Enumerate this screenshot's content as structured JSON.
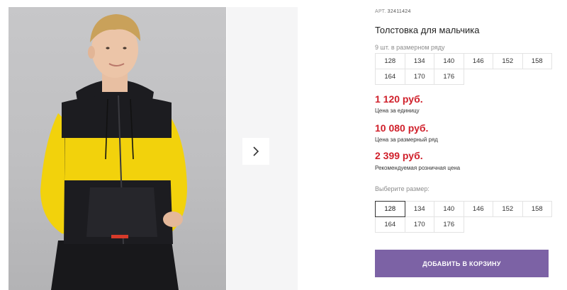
{
  "product": {
    "sku_label": "АРТ.",
    "sku_value": "32411424",
    "title": "Толстовка для мальчика"
  },
  "size_range": {
    "caption": "9 шт. в размерном ряду",
    "sizes": [
      "128",
      "134",
      "140",
      "146",
      "152",
      "158",
      "164",
      "170",
      "176"
    ]
  },
  "prices": [
    {
      "value": "1 120 руб.",
      "label": "Цена за единицу"
    },
    {
      "value": "10 080 руб.",
      "label": "Цена за размерный ряд"
    },
    {
      "value": "2 399 руб.",
      "label": "Рекомендуемая розничная цена"
    }
  ],
  "size_select": {
    "caption": "Выберите размер:",
    "selected": "128",
    "sizes": [
      "128",
      "134",
      "140",
      "146",
      "152",
      "158",
      "164",
      "170",
      "176"
    ]
  },
  "actions": {
    "add_to_cart": "ДОБАВИТЬ В КОРЗИНУ"
  },
  "gallery": {
    "next_icon": "chevron-right-icon"
  },
  "colors": {
    "price": "#d0202b",
    "button": "#7c62a5",
    "hoodie_yellow": "#f2d20c",
    "hoodie_black": "#1c1c20"
  }
}
